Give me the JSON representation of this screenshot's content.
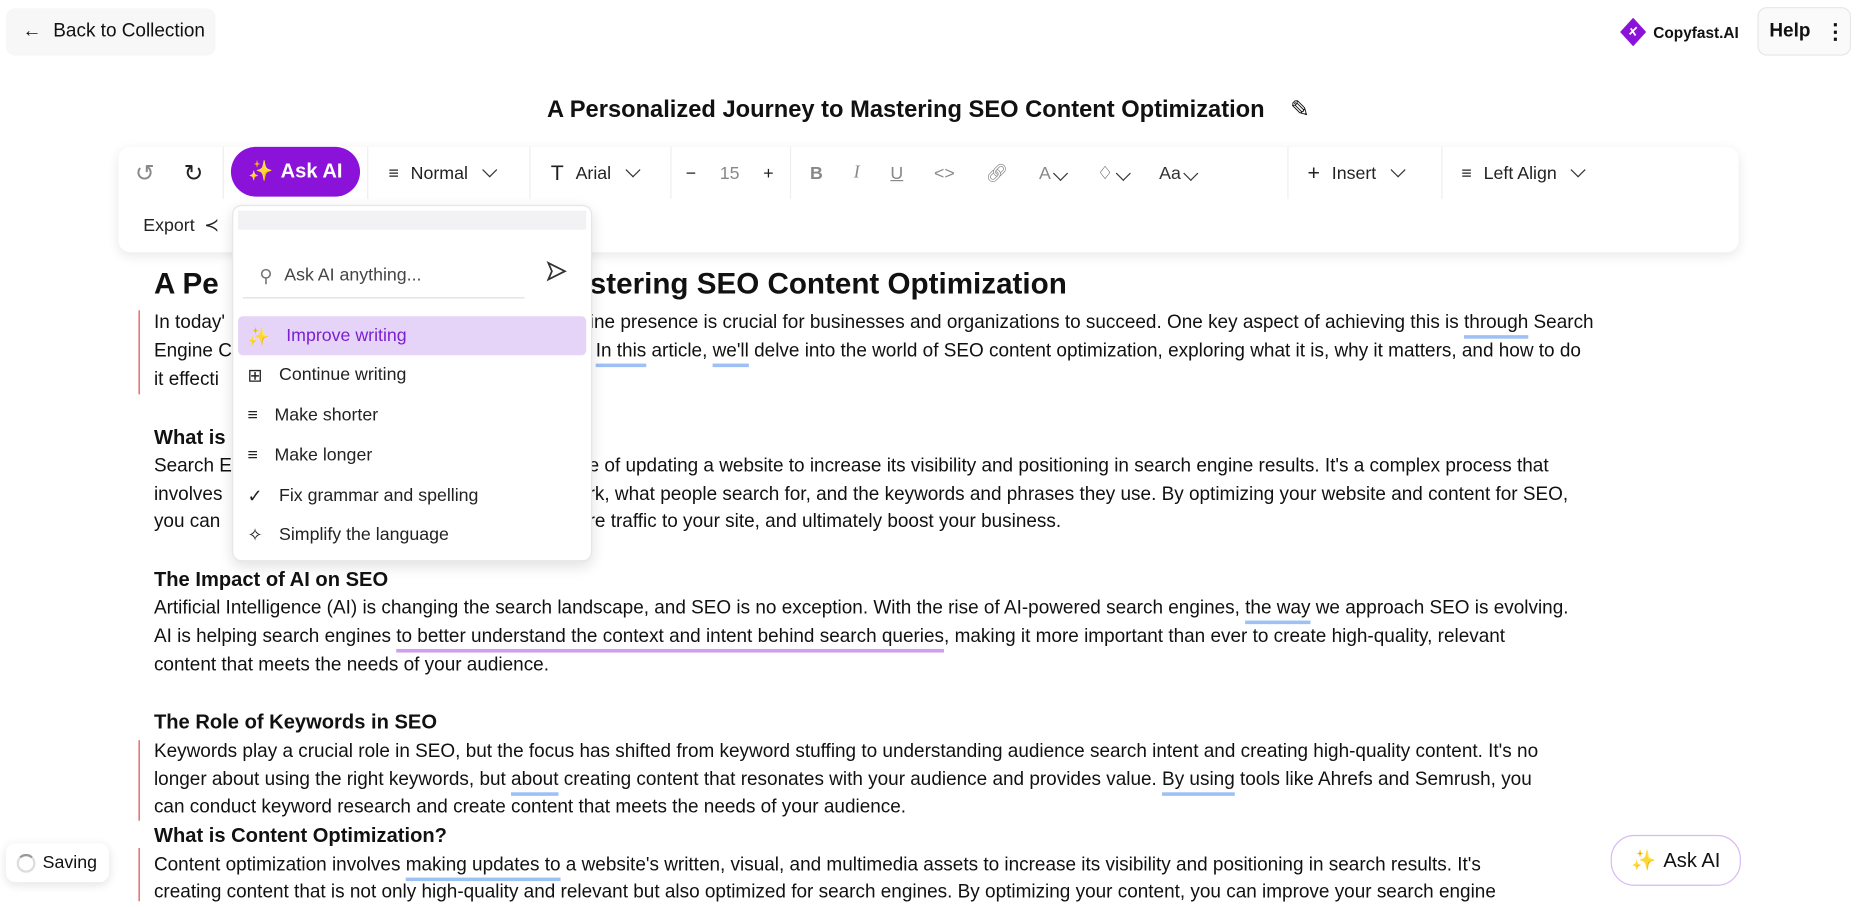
{
  "header": {
    "back_label": "Back to Collection",
    "brand": "Copyfast.AI",
    "help_label": "Help"
  },
  "title": "A Personalized Journey to Mastering SEO Content Optimization",
  "toolbar": {
    "ask_ai": "Ask AI",
    "style": "Normal",
    "font": "Arial",
    "font_size": "15",
    "text_case": "Aa",
    "insert": "Insert",
    "align": "Left Align",
    "export": "Export",
    "accent": "#8b12d9"
  },
  "ai_menu": {
    "placeholder": "Ask AI anything...",
    "items": [
      {
        "label": "Improve writing",
        "icon": "magic-wand-icon",
        "active": true
      },
      {
        "label": "Continue writing",
        "icon": "message-plus-icon"
      },
      {
        "label": "Make shorter",
        "icon": "lines-shorter-icon"
      },
      {
        "label": "Make longer",
        "icon": "lines-longer-icon"
      },
      {
        "label": "Fix grammar and spelling",
        "icon": "check-icon"
      },
      {
        "label": "Simplify the language",
        "icon": "sparkles-icon"
      }
    ]
  },
  "document": {
    "h1": {
      "left": "A Pe",
      "right": "stering SEO Content Optimization"
    },
    "p1": [
      {
        "left": "In today'",
        "right_a": "ine presence is crucial for businesses and organizations to succeed. One key aspect of achieving this is ",
        "right_u": "through",
        "right_b": " Search"
      },
      {
        "left": "Engine C",
        "right_u1": "In this",
        "right_m": " article, ",
        "right_u2": "we'll",
        "right_b": " delve into the world of SEO content optimization, exploring what it is, why it matters, and how to do"
      },
      {
        "left": "it effecti"
      }
    ],
    "h2a": "What is",
    "p2": [
      {
        "left": "Search E",
        "right": "e of updating a website to increase its visibility and positioning in search engine results. It's a complex process that"
      },
      {
        "left": "involves",
        "right": "rk, what people search for, and the keywords and phrases they use. By optimizing your website and content for SEO,"
      },
      {
        "left": "you can",
        "right": "re traffic to your site, and ultimately boost your business."
      }
    ],
    "h2b": "The Impact of AI on SEO",
    "p3": {
      "l1a": "Artificial Intelligence (AI) is changing the search landscape, and SEO is no exception. With the rise of AI-powered search engines, ",
      "l1u": "the way",
      "l1b": " we approach SEO is evolving.",
      "l2a": "AI is helping search engines ",
      "l2u": "to better understand the context and intent behind search queries",
      "l2b": ", making it more important than ever to create high-quality, relevant",
      "l3": "content that meets the needs of your audience."
    },
    "h2c": "The Role of Keywords in SEO",
    "p4": {
      "l1": "Keywords play a crucial role in SEO, but the focus has shifted from keyword stuffing to understanding audience search intent and creating high-quality content. It's no",
      "l2a": "longer about using the right keywords, but ",
      "l2u": "about",
      "l2b": " creating content that resonates with your audience and provides value. ",
      "l2u2": "By using",
      "l2c": " tools like Ahrefs and Semrush, you",
      "l3": "can conduct keyword research and create content that meets the needs of your audience."
    },
    "h2d": "What is Content Optimization?",
    "p5": {
      "l1a": "Content optimization involves ",
      "l1u": "making updates to",
      "l1b": " a website's written, visual, and multimedia assets to increase its visibility and positioning in search results. It's",
      "l2": "creating content that is not only high-quality and relevant but also optimized for search engines. By optimizing your content, you can improve your search engine"
    }
  },
  "status": {
    "saving": "Saving"
  },
  "float_ask_ai": "Ask AI"
}
